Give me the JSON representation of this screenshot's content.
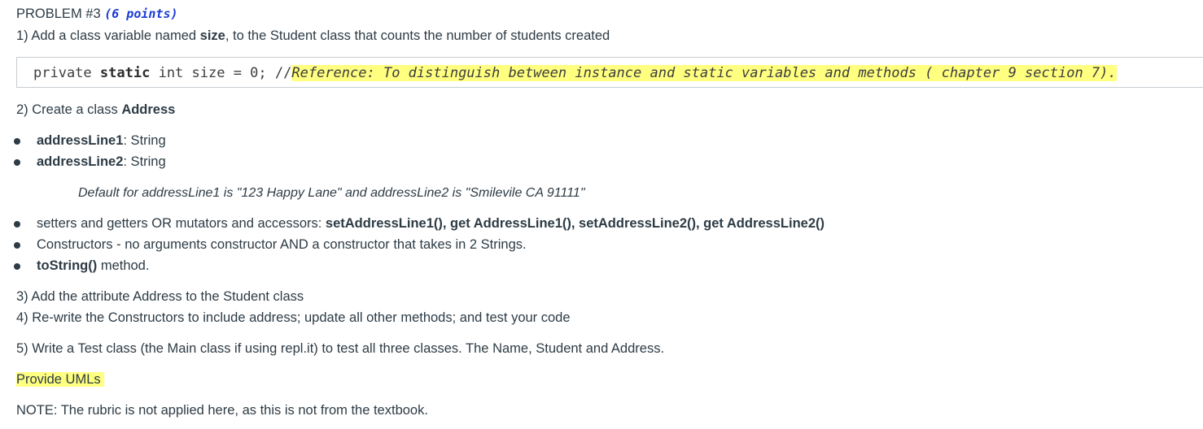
{
  "problem": {
    "title": "PROBLEM #3",
    "points": "(6 points)"
  },
  "step1": {
    "prefix": "1) Add a class variable named ",
    "bold": "size",
    "suffix": ", to the Student class that counts the number of students created"
  },
  "code": {
    "kw1": "private",
    "kw2": "static",
    "rest": "int size = 0;",
    "comment_prefix": "//",
    "reference": "Reference: To distinguish between instance and static variables and methods ( chapter 9 section 7)."
  },
  "step2": {
    "prefix": "2) Create a class ",
    "bold": "Address"
  },
  "fields": [
    {
      "name": "addressLine1",
      "type": ": String"
    },
    {
      "name": "addressLine2",
      "type": ": String"
    }
  ],
  "default_note": "Default for addressLine1 is \"123 Happy Lane\" and addressLine2 is \"Smilevile CA 91111\"",
  "methods": {
    "setters": {
      "prefix": "setters and getters OR mutators and accessors: ",
      "bold": "setAddressLine1(), get AddressLine1(), setAddressLine2(), get AddressLine2()"
    },
    "constructors": "Constructors - no arguments constructor AND a constructor that takes in 2 Strings.",
    "tostring": {
      "bold": "toString()",
      "suffix": " method."
    }
  },
  "step3": "3) Add the attribute Address to the Student class",
  "step4": "4) Re-write the Constructors to include address; update all other methods; and test your code",
  "step5": "5) Write a Test class (the Main class if using repl.it) to test all three classes. The Name, Student and Address.",
  "uml": "Provide UMLs",
  "note": "NOTE: The rubric is not applied here, as this is not from the textbook."
}
